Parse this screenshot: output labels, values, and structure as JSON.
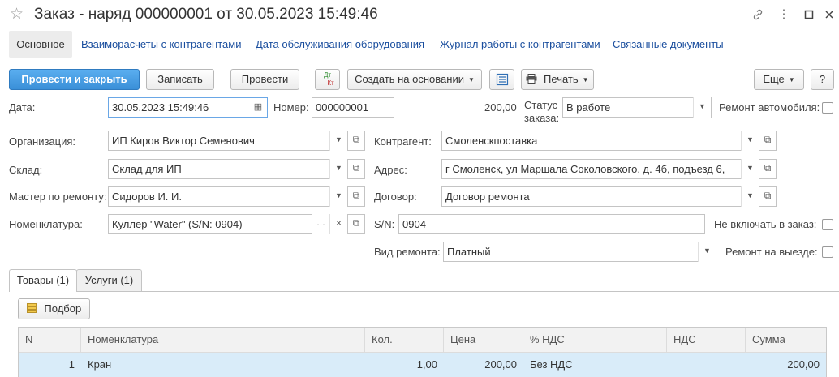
{
  "window": {
    "title": "Заказ - наряд 000000001 от 30.05.2023 15:49:46"
  },
  "nav": {
    "main": "Основное",
    "links": [
      "Взаиморасчеты с контрагентами",
      "Дата обслуживания оборудования",
      "Журнал работы с контрагентами",
      "Связанные документы"
    ]
  },
  "toolbar": {
    "post_close": "Провести и закрыть",
    "save": "Записать",
    "post": "Провести",
    "dt_kt_top": "Дт",
    "dt_kt_bottom": "Кт",
    "create_based": "Создать на основании",
    "print": "Печать",
    "more": "Еще",
    "help": "?"
  },
  "form": {
    "date_label": "Дата:",
    "date_value": "30.05.2023 15:49:46",
    "number_label": "Номер:",
    "number_value": "000000001",
    "amount": "200,00",
    "status_label_1": "Статус",
    "status_label_2": "заказа:",
    "status_value": "В работе",
    "car_repair_label": "Ремонт автомобиля:",
    "org_label": "Организация:",
    "org_value": "ИП Киров Виктор Семенович",
    "counterparty_label": "Контрагент:",
    "counterparty_value": "Смоленскпоставка",
    "warehouse_label": "Склад:",
    "warehouse_value": "Склад для ИП",
    "address_label": "Адрес:",
    "address_value": "г Смоленск,  ул Маршала Соколовского,  д. 4б,  подъезд 6,",
    "master_label": "Мастер по ремонту:",
    "master_value": "Сидоров И. И.",
    "contract_label": "Договор:",
    "contract_value": "Договор ремонта",
    "nomenclature_label": "Номенклатура:",
    "nomenclature_value": "Куллер \"Water\" (S/N: 0904)",
    "sn_label": "S/N:",
    "sn_value": "0904",
    "exclude_label": "Не включать в заказ:",
    "repair_type_label": "Вид ремонта:",
    "repair_type_value": "Платный",
    "onsite_label": "Ремонт на выезде:"
  },
  "tabs": [
    "Товары (1)",
    "Услуги (1)"
  ],
  "pick_button": "Подбор",
  "table": {
    "headers": [
      "N",
      "Номенклатура",
      "Кол.",
      "Цена",
      "% НДС",
      "НДС",
      "Сумма"
    ],
    "rows": [
      {
        "n": "1",
        "item": "Кран",
        "qty": "1,00",
        "price": "200,00",
        "vat_rate": "Без НДС",
        "vat": "",
        "sum": "200,00"
      }
    ]
  }
}
